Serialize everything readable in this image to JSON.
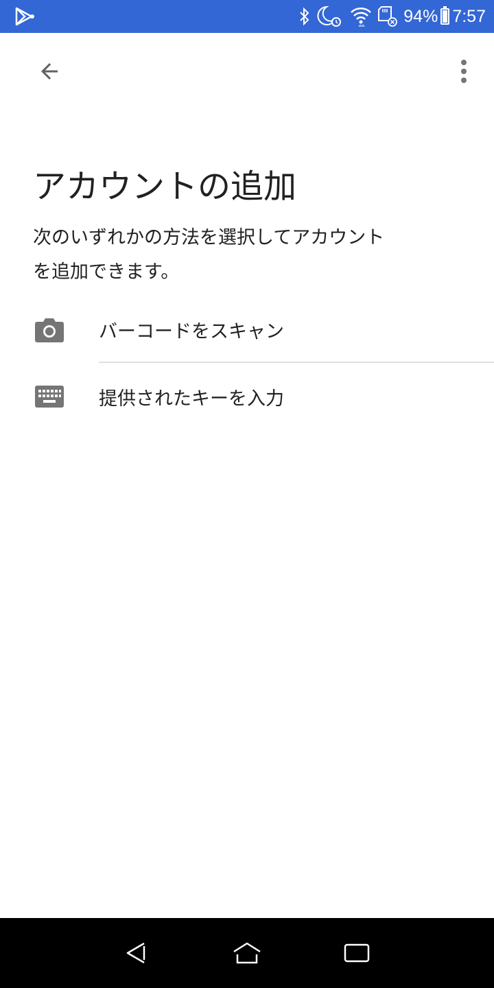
{
  "status_bar": {
    "battery_percent": "94%",
    "time": "7:57",
    "icons": [
      "play-store-icon",
      "bluetooth-icon",
      "night-alarm-icon",
      "wifi-icon",
      "sd-card-icon",
      "battery-icon"
    ],
    "background_color": "#3367d6"
  },
  "app_bar": {
    "back_icon": "arrow-back-icon",
    "menu_icon": "more-vert-icon"
  },
  "page": {
    "title": "アカウントの追加",
    "description_line1": "次のいずれかの方法を選択してアカウント",
    "description_line2": "を追加できます。"
  },
  "options": [
    {
      "icon": "camera-icon",
      "label": "バーコードをスキャン"
    },
    {
      "icon": "keyboard-icon",
      "label": "提供されたキーを入力"
    }
  ],
  "nav_bar": {
    "icons": [
      "nav-back-icon",
      "nav-home-icon",
      "nav-recents-icon"
    ]
  }
}
